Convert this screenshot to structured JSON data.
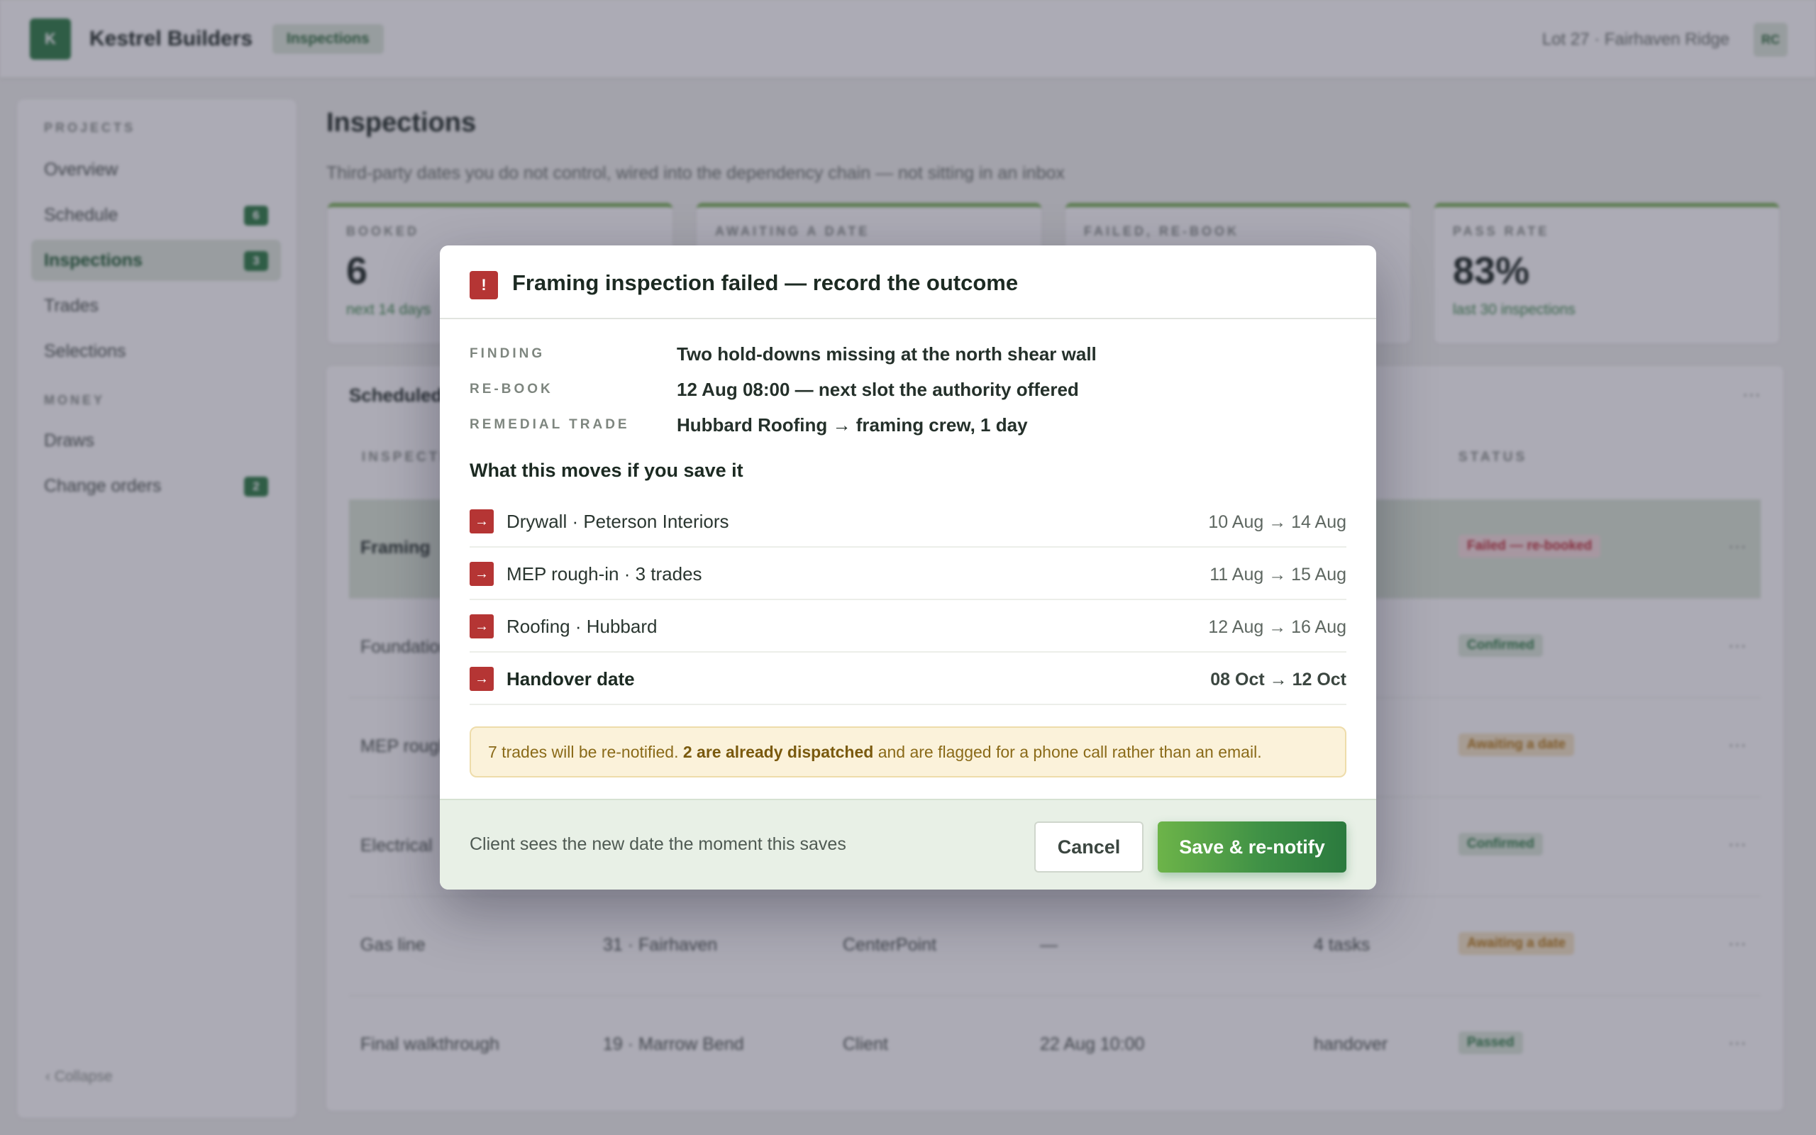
{
  "app": {
    "logo_letter": "K",
    "brand": "Kestrel Builders",
    "top_tag": "Inspections",
    "lot": "Lot 27 · Fairhaven Ridge",
    "avatar": "RC"
  },
  "sidebar": {
    "section_projects": "PROJECTS",
    "section_money": "MONEY",
    "items": [
      {
        "label": "Overview",
        "badge": ""
      },
      {
        "label": "Schedule",
        "badge": "6"
      },
      {
        "label": "Inspections",
        "badge": "3",
        "active": true
      },
      {
        "label": "Trades",
        "badge": ""
      },
      {
        "label": "Selections",
        "badge": ""
      },
      {
        "label": "Draws",
        "badge": ""
      },
      {
        "label": "Change orders",
        "badge": "2"
      }
    ],
    "collapse": "‹ Collapse"
  },
  "page": {
    "title": "Inspections",
    "subtitle": "Third-party dates you do not control, wired into the dependency chain — not sitting in an inbox"
  },
  "stats": [
    {
      "label": "BOOKED",
      "value": "6",
      "note": "next 14 days"
    },
    {
      "label": "AWAITING A DATE",
      "value": "",
      "note": ""
    },
    {
      "label": "FAILED, RE-BOOK",
      "value": "",
      "note": ""
    },
    {
      "label": "PASS RATE",
      "value": "83%",
      "note": "last 30 inspections"
    }
  ],
  "table": {
    "title": "Scheduled",
    "menu": "···",
    "headers": {
      "inspection": "INSPECTION",
      "status": "STATUS"
    },
    "rows": [
      {
        "inspection": "Framing",
        "lot": "",
        "authority": "",
        "date": "",
        "blocks": "",
        "status": "Failed — re-booked",
        "status_kind": "fail"
      },
      {
        "inspection": "Foundation",
        "lot": "",
        "authority": "",
        "date": "",
        "blocks": "",
        "status": "Confirmed",
        "status_kind": "ok"
      },
      {
        "inspection": "MEP rough-in",
        "lot": "",
        "authority": "",
        "date": "",
        "blocks": "",
        "status": "Awaiting a date",
        "status_kind": "wait"
      },
      {
        "inspection": "Electrical",
        "lot": "",
        "authority": "",
        "date": "",
        "blocks": "",
        "status": "Confirmed",
        "status_kind": "ok"
      },
      {
        "inspection": "Gas line",
        "lot": "31 · Fairhaven",
        "authority": "CenterPoint",
        "date": "—",
        "blocks": "4 tasks",
        "status": "Awaiting a date",
        "status_kind": "wait"
      },
      {
        "inspection": "Final walkthrough",
        "lot": "19 · Marrow Bend",
        "authority": "Client",
        "date": "22 Aug 10:00",
        "blocks": "handover",
        "status": "Passed",
        "status_kind": "ok"
      }
    ]
  },
  "modal": {
    "alert_icon": "!",
    "title": "Framing inspection failed — record the outcome",
    "finding_label": "FINDING",
    "finding_value": "Two hold-downs missing at the north shear wall",
    "rebook_label": "RE-BOOK",
    "rebook_value": "12 Aug 08:00 — next slot the authority offered",
    "trade_label": "REMEDIAL TRADE",
    "trade_value": "Hubbard Roofing → framing crew, 1 day",
    "moves_title": "What this moves if you save it",
    "moves": [
      {
        "label": "Drywall · Peterson Interiors",
        "dates": "10 Aug → 14 Aug",
        "strong": false
      },
      {
        "label": "MEP rough-in · 3 trades",
        "dates": "11 Aug → 15 Aug",
        "strong": false
      },
      {
        "label": "Roofing · Hubbard",
        "dates": "12 Aug → 16 Aug",
        "strong": false
      },
      {
        "label": "Handover date",
        "dates": "08 Oct → 12 Oct",
        "strong": true
      }
    ],
    "move_icon": "→",
    "notice_pre": "7 trades will be re-notified.",
    "notice_bold": "2 are already dispatched",
    "notice_post": "and are flagged for a phone call rather than an email.",
    "footer_note": "Client sees the new date the moment this saves",
    "cancel_label": "Cancel",
    "save_label": "Save & re-notify"
  },
  "colors": {
    "brand_green": "#2f7d46",
    "danger_red": "#b53534",
    "notice_bg": "#fbf2da"
  }
}
